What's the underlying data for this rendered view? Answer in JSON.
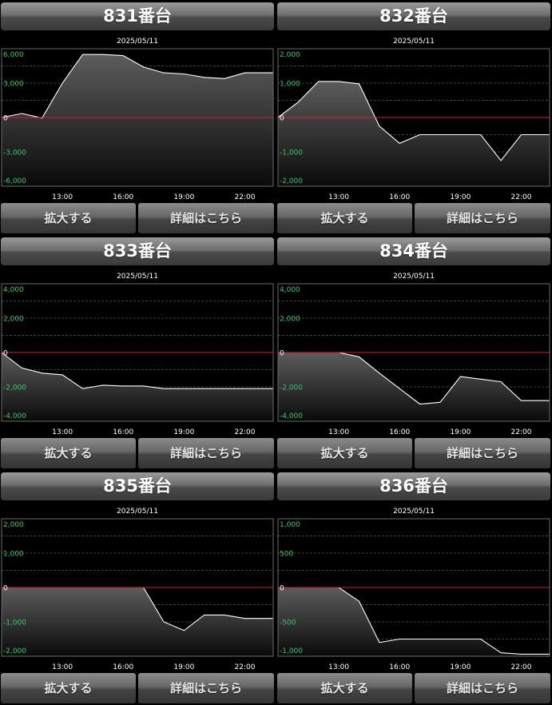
{
  "buttons": {
    "zoom_label": "拡大する",
    "detail_label": "詳細はこちら"
  },
  "colors": {
    "grid_border": "#6a6a6a",
    "zero_line": "#d62020",
    "line": "#ffffff",
    "tick_y": "#33cc66",
    "tick_x": "#ffffff"
  },
  "panels": [
    {
      "title": "831番台",
      "chart_data": {
        "type": "area",
        "title": "2025/05/11",
        "xlabel": "",
        "ylabel": "",
        "x_ticks": [
          "13:00",
          "16:00",
          "19:00",
          "22:00"
        ],
        "y_ticks": [
          "6,000",
          "3,000",
          "0",
          "-3,000",
          "-6,000"
        ],
        "y_tick_values": [
          6000,
          3000,
          0,
          -3000,
          -6000
        ],
        "ylim": [
          -6000,
          6000
        ],
        "xlim": [
          10,
          23.4
        ],
        "series": [
          {
            "x": [
              10,
              11,
              12,
              13,
              14,
              15,
              16,
              17,
              18,
              19,
              20,
              21,
              22,
              23.4
            ],
            "y": [
              0,
              350,
              -50,
              3000,
              5500,
              5500,
              5400,
              4400,
              3900,
              3800,
              3500,
              3400,
              3900,
              3900
            ]
          }
        ]
      }
    },
    {
      "title": "832番台",
      "chart_data": {
        "type": "area",
        "title": "2025/05/11",
        "xlabel": "",
        "ylabel": "",
        "x_ticks": [
          "13:00",
          "16:00",
          "19:00",
          "22:00"
        ],
        "y_ticks": [
          "2,000",
          "1,000",
          "0",
          "-1,000",
          "-2,000"
        ],
        "y_tick_values": [
          2000,
          1000,
          0,
          -1000,
          -2000
        ],
        "ylim": [
          -2000,
          2000
        ],
        "xlim": [
          10,
          23.4
        ],
        "series": [
          {
            "x": [
              10,
              11,
              12,
              13,
              14,
              15,
              16,
              17,
              18,
              19,
              20,
              21,
              22,
              23.4
            ],
            "y": [
              0,
              450,
              1050,
              1050,
              980,
              -250,
              -750,
              -500,
              -500,
              -500,
              -500,
              -1250,
              -500,
              -500
            ]
          }
        ]
      }
    },
    {
      "title": "833番台",
      "chart_data": {
        "type": "area",
        "title": "2025/05/11",
        "xlabel": "",
        "ylabel": "",
        "x_ticks": [
          "13:00",
          "16:00",
          "19:00",
          "22:00"
        ],
        "y_ticks": [
          "4,000",
          "2,000",
          "0",
          "-2,000",
          "-4,000"
        ],
        "y_tick_values": [
          4000,
          2000,
          0,
          -2000,
          -4000
        ],
        "ylim": [
          -4000,
          4000
        ],
        "xlim": [
          10,
          23.4
        ],
        "series": [
          {
            "x": [
              10,
              11,
              12,
              13,
              14,
              15,
              16,
              17,
              18,
              19,
              20,
              21,
              22,
              23.4
            ],
            "y": [
              0,
              -900,
              -1200,
              -1300,
              -2100,
              -1900,
              -1950,
              -1950,
              -2100,
              -2100,
              -2100,
              -2100,
              -2100,
              -2100
            ]
          }
        ]
      }
    },
    {
      "title": "834番台",
      "chart_data": {
        "type": "area",
        "title": "2025/05/11",
        "xlabel": "",
        "ylabel": "",
        "x_ticks": [
          "13:00",
          "16:00",
          "19:00",
          "22:00"
        ],
        "y_ticks": [
          "4,000",
          "2,000",
          "0",
          "-2,000",
          "-4,000"
        ],
        "y_tick_values": [
          4000,
          2000,
          0,
          -2000,
          -4000
        ],
        "ylim": [
          -4000,
          4000
        ],
        "xlim": [
          10,
          23.4
        ],
        "series": [
          {
            "x": [
              10,
              11,
              12,
              13,
              14,
              15,
              16,
              17,
              18,
              19,
              20,
              21,
              22,
              23.4
            ],
            "y": [
              0,
              0,
              0,
              0,
              -250,
              -1200,
              -2100,
              -3000,
              -2900,
              -1400,
              -1550,
              -1700,
              -2800,
              -2800
            ]
          }
        ]
      }
    },
    {
      "title": "835番台",
      "chart_data": {
        "type": "area",
        "title": "2025/05/11",
        "xlabel": "",
        "ylabel": "",
        "x_ticks": [
          "13:00",
          "16:00",
          "19:00",
          "22:00"
        ],
        "y_ticks": [
          "2,000",
          "1,000",
          "0",
          "-1,000",
          "-2,000"
        ],
        "y_tick_values": [
          2000,
          1000,
          0,
          -1000,
          -2000
        ],
        "ylim": [
          -2000,
          2000
        ],
        "xlim": [
          10,
          23.4
        ],
        "series": [
          {
            "x": [
              10,
              11,
              12,
              13,
              14,
              15,
              16,
              17,
              18,
              19,
              20,
              21,
              22,
              23.4
            ],
            "y": [
              0,
              0,
              0,
              0,
              0,
              0,
              0,
              0,
              -1000,
              -1250,
              -800,
              -800,
              -900,
              -900
            ]
          }
        ]
      }
    },
    {
      "title": "836番台",
      "chart_data": {
        "type": "area",
        "title": "2025/05/11",
        "xlabel": "",
        "ylabel": "",
        "x_ticks": [
          "13:00",
          "16:00",
          "19:00",
          "22:00"
        ],
        "y_ticks": [
          "1,000",
          "500",
          "0",
          "-500",
          "-1,000"
        ],
        "y_tick_values": [
          1000,
          500,
          0,
          -500,
          -1000
        ],
        "ylim": [
          -1000,
          1000
        ],
        "xlim": [
          10,
          23.4
        ],
        "series": [
          {
            "x": [
              10,
              11,
              12,
              13,
              14,
              15,
              16,
              17,
              18,
              19,
              20,
              21,
              22,
              23.4
            ],
            "y": [
              0,
              0,
              0,
              0,
              -200,
              -800,
              -750,
              -750,
              -750,
              -750,
              -750,
              -950,
              -970,
              -970
            ]
          }
        ]
      }
    }
  ]
}
